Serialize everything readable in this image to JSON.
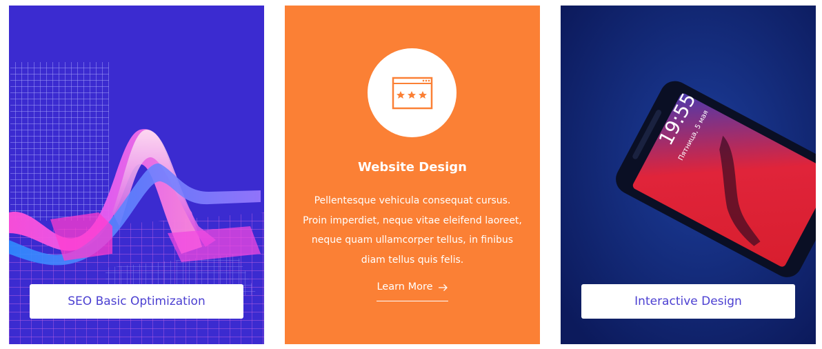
{
  "colors": {
    "card1_bg": "#3b2bd0",
    "card2_bg": "#fb8035",
    "card3_bg": "#102270",
    "label_text": "#4b3fd1"
  },
  "cards": [
    {
      "label": "SEO Basic Optimization",
      "image": "abstract-3d-wave-illustration"
    },
    {
      "icon": "browser-rating-icon",
      "title": "Website Design",
      "description": [
        "Pellentesque vehicula consequat cursus.",
        "Proin imperdiet, neque vitae eleifend laoreet,",
        "neque quam ullamcorper tellus, in finibus",
        "diam tellus quis felis."
      ],
      "link_label": "Learn More",
      "link_icon": "arrow-right-icon"
    },
    {
      "label": "Interactive Design",
      "image": "smartphone-photo",
      "phone_time": "19:55",
      "phone_date": "Пятница, 5 мая"
    }
  ]
}
